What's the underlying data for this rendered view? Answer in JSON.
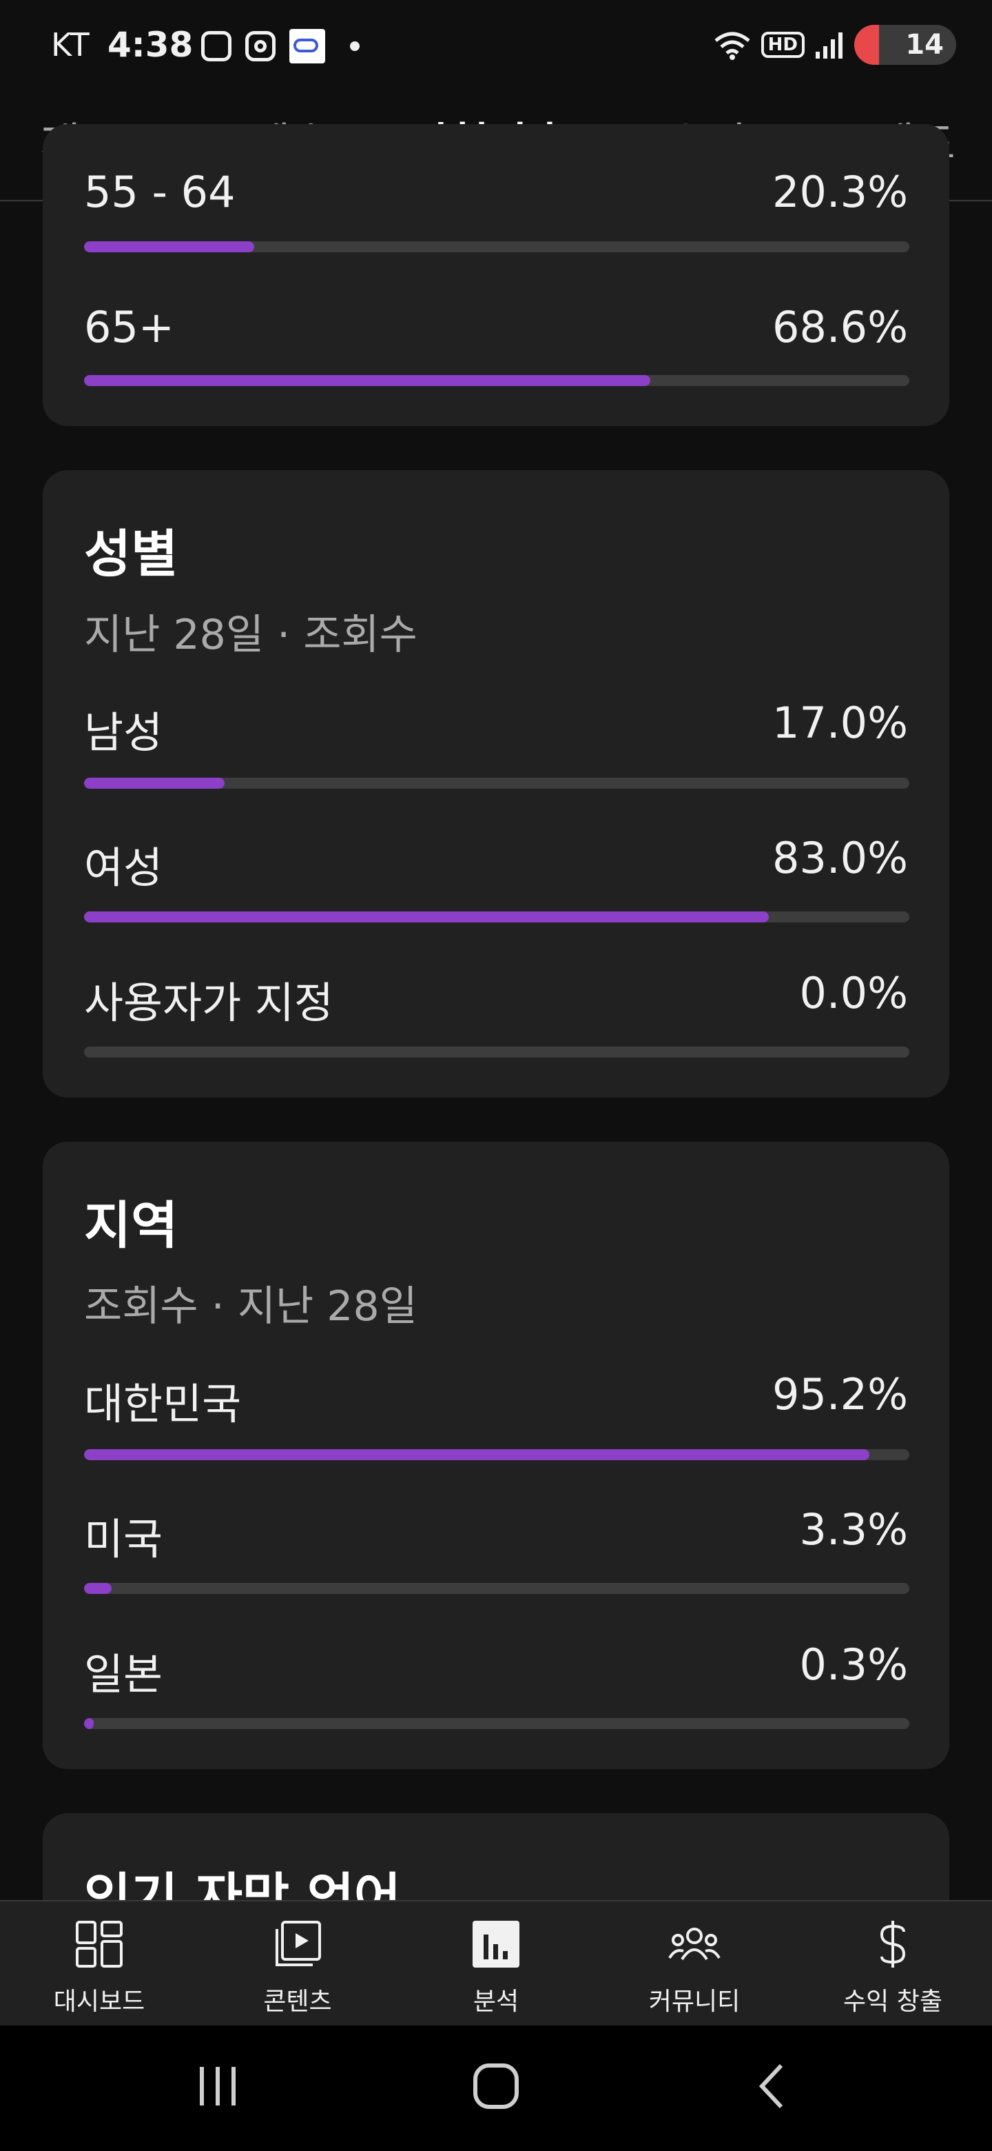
{
  "status_bar": {
    "carrier": "KT",
    "time": "4:38",
    "hd": "HD",
    "battery": "14"
  },
  "tabs": [
    {
      "label": "개요"
    },
    {
      "label": "콘텐츠"
    },
    {
      "label": "시청자층",
      "active": true
    },
    {
      "label": "수익"
    },
    {
      "label": "트렌드"
    }
  ],
  "age_card": {
    "partial_label": "55 - 64",
    "partial_value": "20.3%",
    "partial_fraction": 0.206,
    "rows": [
      {
        "label": "65+",
        "value": "68.6%",
        "fraction": 0.686
      }
    ]
  },
  "gender_card": {
    "title": "성별",
    "subtitle": "지난 28일 · 조회수",
    "rows": [
      {
        "label": "남성",
        "value": "17.0%",
        "fraction": 0.17
      },
      {
        "label": "여성",
        "value": "83.0%",
        "fraction": 0.83
      },
      {
        "label": "사용자가 지정",
        "value": "0.0%",
        "fraction": 0.0
      }
    ]
  },
  "region_card": {
    "title": "지역",
    "subtitle": "조회수 · 지난 28일",
    "rows": [
      {
        "label": "대한민국",
        "value": "95.2%",
        "fraction": 0.952
      },
      {
        "label": "미국",
        "value": "3.3%",
        "fraction": 0.033
      },
      {
        "label": "일본",
        "value": "0.3%",
        "fraction": 0.012
      }
    ]
  },
  "next_card": {
    "title": "인기 자막 언어"
  },
  "bottom_nav": [
    {
      "label": "대시보드",
      "icon": "dashboard-icon"
    },
    {
      "label": "콘텐츠",
      "icon": "content-icon"
    },
    {
      "label": "분석",
      "icon": "analytics-icon",
      "active": true
    },
    {
      "label": "커뮤니티",
      "icon": "community-icon"
    },
    {
      "label": "수익 창출",
      "icon": "dollar-icon"
    }
  ],
  "colors": {
    "bar_fill": "#8c3fc7",
    "bar_track": "#3d3d3d",
    "card": "#212121",
    "background": "#0f0f0f"
  }
}
